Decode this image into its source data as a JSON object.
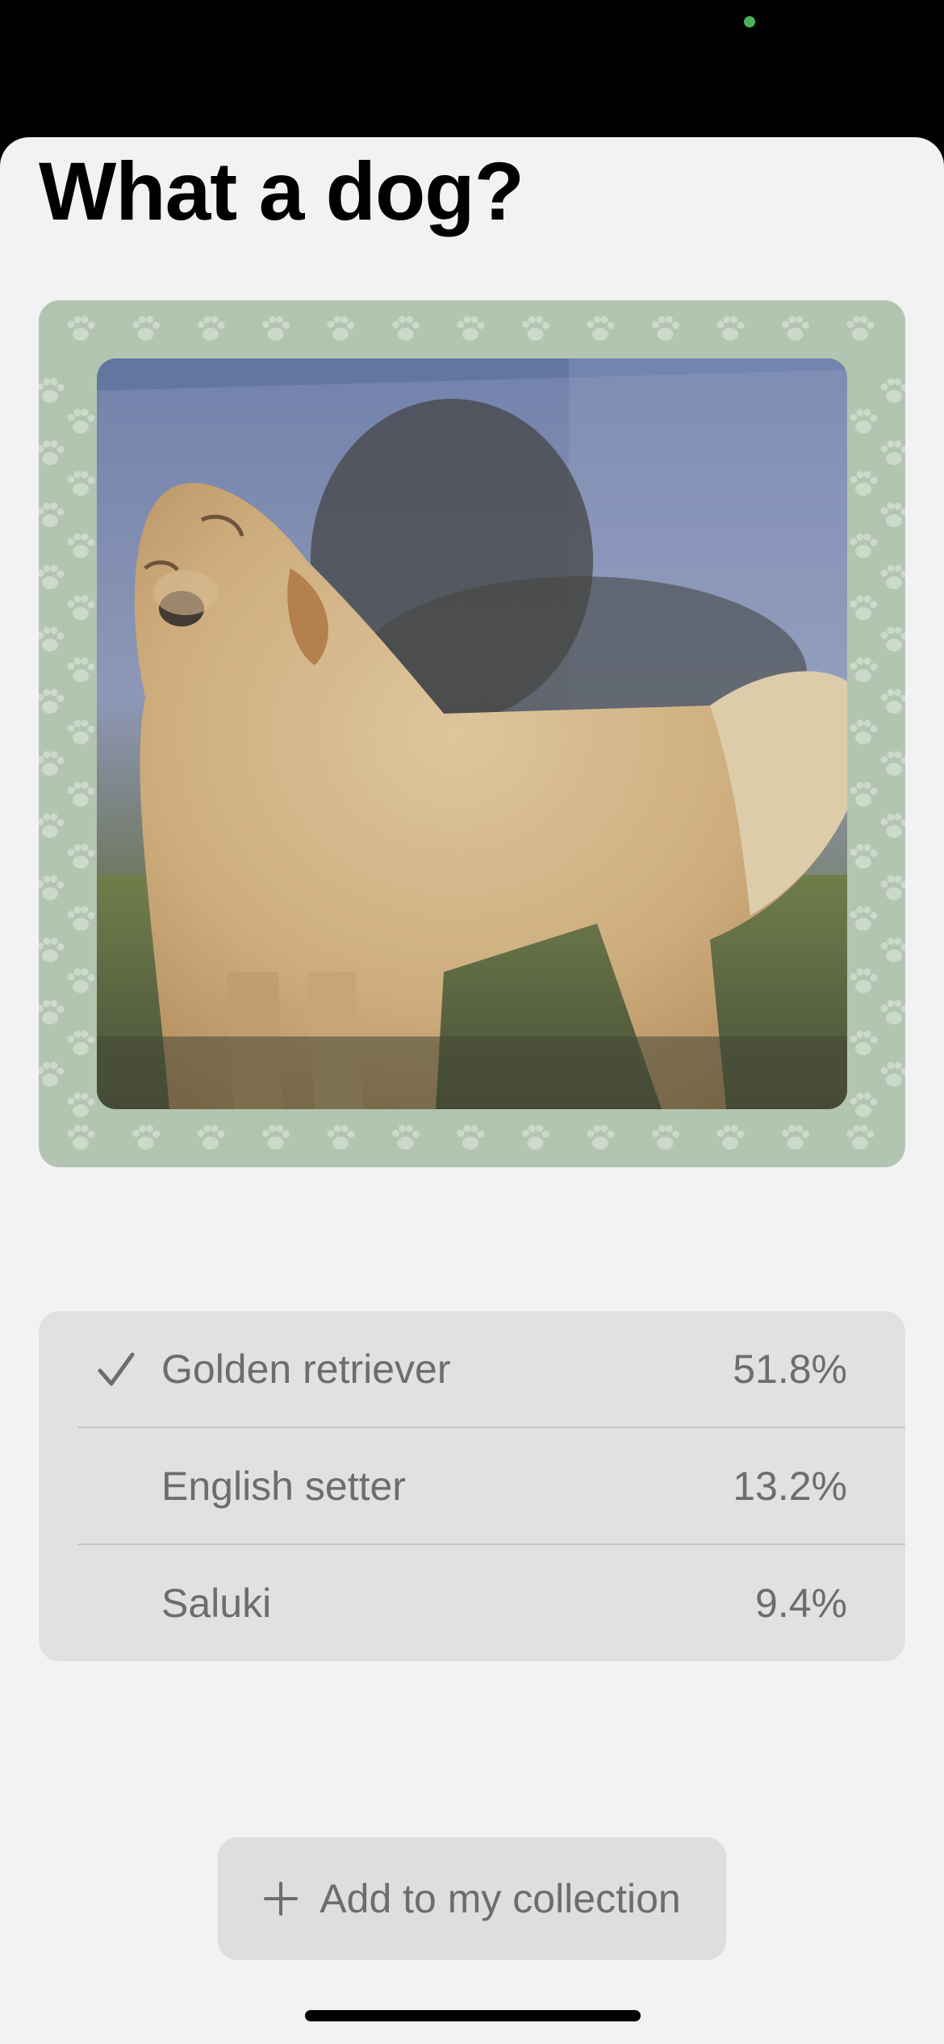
{
  "screen": {
    "title": "What a dog?"
  },
  "photo": {
    "subject": "Golden retriever standing on grass, photographed through glass"
  },
  "results": [
    {
      "label": "Golden retriever",
      "confidence": "51.8%",
      "selected": true
    },
    {
      "label": "English setter",
      "confidence": "13.2%",
      "selected": false
    },
    {
      "label": "Saluki",
      "confidence": "9.4%",
      "selected": false
    }
  ],
  "actions": {
    "add_label": "Add to my collection"
  },
  "icons": {
    "selected": "checkmark-icon",
    "add": "plus-icon",
    "frame_pattern": "paw-print-icon"
  },
  "colors": {
    "background": "#f2f2f4",
    "frame": "#b2c5b1",
    "paw": "#cdd9c9",
    "results_panel": "#e0e1e0",
    "secondary_text": "#6b6e6b",
    "status_dot": "#4cb05a"
  }
}
